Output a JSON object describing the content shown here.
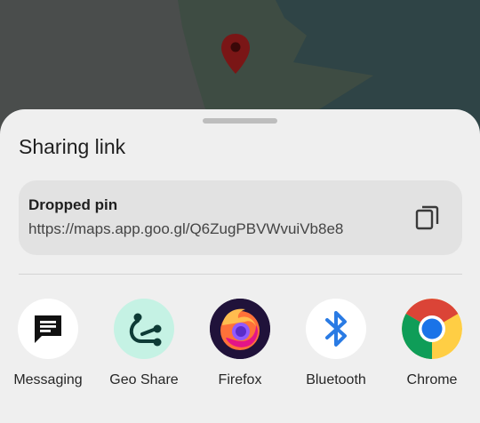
{
  "map": {
    "pin_icon": "location-pin-icon",
    "colors": {
      "land": "#4a4d4c",
      "water": "#2f4446",
      "green": "#3e4c43",
      "pin": "#7a1616"
    }
  },
  "sheet": {
    "title": "Sharing link",
    "link": {
      "title": "Dropped pin",
      "url": "https://maps.app.goo.gl/Q6ZugPBVWvuiVb8e8",
      "copy_icon": "copy-icon"
    },
    "apps": [
      {
        "label": "Messaging",
        "icon": "message-bubble-icon",
        "color": "#ffffff"
      },
      {
        "label": "Geo Share",
        "icon": "geo-share-icon",
        "color": "#c5f2e4"
      },
      {
        "label": "Firefox",
        "icon": "firefox-icon",
        "color": "#20123a"
      },
      {
        "label": "Bluetooth",
        "icon": "bluetooth-icon",
        "color": "#2a7be4"
      },
      {
        "label": "Chrome",
        "icon": "chrome-icon",
        "color": "#1a73e8"
      }
    ]
  }
}
